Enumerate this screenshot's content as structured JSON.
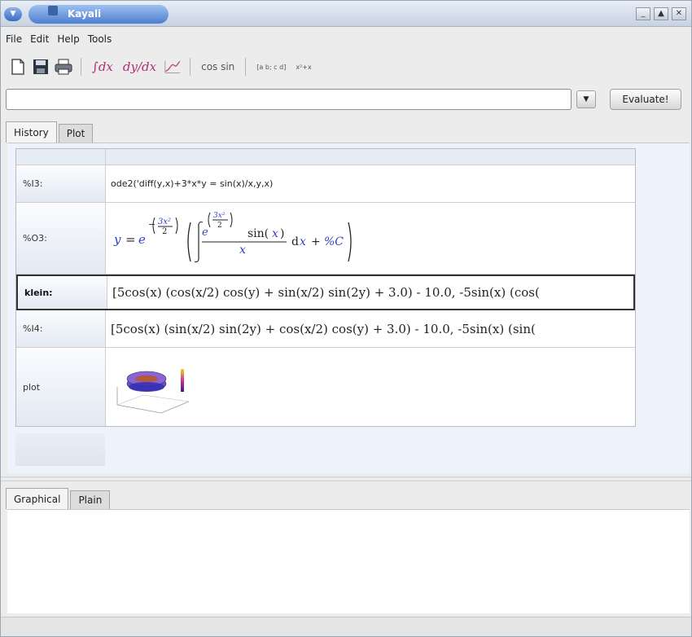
{
  "window": {
    "title": "Kayali"
  },
  "menubar": {
    "items": [
      "File",
      "Edit",
      "Help",
      "Tools"
    ]
  },
  "toolbar": {
    "integral_label": "∫dx",
    "diff_label": "dy/dx",
    "plot_icon": "plot-curve-icon",
    "trig_label": "cos sin",
    "matrix_label": "[a b; c d]",
    "poly_label": "x²+x"
  },
  "input": {
    "value": "",
    "dropdown_icon": "chevron-down-icon",
    "evaluate_label": "Evaluate!"
  },
  "tabs": {
    "history": "History",
    "plot": "Plot"
  },
  "history": {
    "rows": [
      {
        "label": "%I3:",
        "content": "ode2('diff(y,x)+3*x*y = sin(x)/x,y,x)"
      },
      {
        "label": "%O3:",
        "content": "y = e^(-(3x²/2)) ( ∫ e^((3x²)/2) sin(x)/x dx + %C )"
      },
      {
        "label": "klein:",
        "content": "[5cos(x) (cos(x/2) cos(y) + sin(x/2) sin(2y) + 3.0) - 10.0, -5sin(x) (cos("
      },
      {
        "label": "%I4:",
        "content": "[5cos(x) (sin(x/2) sin(2y) + cos(x/2) cos(y) + 3.0) - 10.0, -5sin(x) (sin("
      },
      {
        "label": "plot",
        "content": "3d-plot-thumbnail"
      }
    ]
  },
  "bottom_tabs": {
    "graphical": "Graphical",
    "plain": "Plain"
  }
}
